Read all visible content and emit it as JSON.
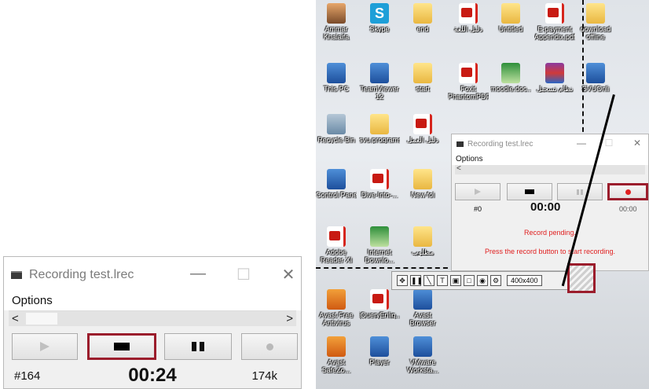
{
  "recorder_large": {
    "title": "Recording test.lrec",
    "menu": "Options",
    "minimize_glyph": "—",
    "maximize_glyph": "☐",
    "close_glyph": "✕",
    "scroll_left": "<",
    "scroll_right": ">",
    "frames": "#164",
    "time": "00:24",
    "size": "174k"
  },
  "recorder_small": {
    "title": "Recording test.lrec",
    "menu": "Options",
    "minimize_glyph": "—",
    "maximize_glyph": "☐",
    "close_glyph": "✕",
    "scroll_left": "<",
    "frames": "#0",
    "time": "00:00",
    "size": "00:00",
    "pending": "Record pending.",
    "hint": "Press the record button to start recording."
  },
  "capture_toolbar": {
    "size_value": "400x400"
  },
  "desktop_icons": [
    {
      "label": "Ammar\nKhalaifa",
      "icon": "person-icon"
    },
    {
      "label": "Skype",
      "icon": "skype-icon"
    },
    {
      "label": "end",
      "icon": "folder-icon"
    },
    {
      "label": "دليل اللغة",
      "icon": "pdf-icon"
    },
    {
      "label": "Untitled",
      "icon": "file-icon"
    },
    {
      "label": "E-payment\nAppendix.pdf",
      "icon": "pdf-icon"
    },
    {
      "label": "download\noffline",
      "icon": "folder-icon"
    },
    {
      "label": "This PC",
      "icon": "computer-icon"
    },
    {
      "label": "TeamViewer\n12",
      "icon": "teamviewer-icon"
    },
    {
      "label": "start",
      "icon": "folder-icon"
    },
    {
      "label": "Foxit\nPhantomPDF",
      "icon": "foxit-icon"
    },
    {
      "label": "moodle.doc...",
      "icon": "document-icon"
    },
    {
      "label": "نظام تسجيل",
      "icon": "rar-icon"
    },
    {
      "label": "SVUOnli",
      "icon": "app-icon"
    },
    {
      "label": "Recycle Bin",
      "icon": "recycle-bin-icon"
    },
    {
      "label": "svu programs",
      "icon": "folder-icon"
    },
    {
      "label": "دليل العمل",
      "icon": "pdf-icon"
    },
    {
      "label": "Control Panel",
      "icon": "control-panel-icon"
    },
    {
      "label": "Dive-Into-...",
      "icon": "pdf-icon"
    },
    {
      "label": "New fol",
      "icon": "folder-icon"
    },
    {
      "label": "Adobe\nReader XI",
      "icon": "adobe-reader-icon"
    },
    {
      "label": "Internet\nDownlo...",
      "icon": "idm-icon"
    },
    {
      "label": "مطلوب",
      "icon": "folder-icon"
    },
    {
      "label": "Avast Free\nAntivirus",
      "icon": "avast-icon"
    },
    {
      "label": "jQueryEnlig...",
      "icon": "pdf-icon"
    },
    {
      "label": "Avast\nBrowser",
      "icon": "avast-browser-icon"
    },
    {
      "label": "Avast\nSafeZo...",
      "icon": "safezone-icon"
    },
    {
      "label": "Player",
      "icon": "player-icon"
    },
    {
      "label": "VMware\nWorksta...",
      "icon": "vmware-icon"
    }
  ],
  "colors": {
    "highlight": "#9b1d2c",
    "record_red": "#e02020"
  }
}
